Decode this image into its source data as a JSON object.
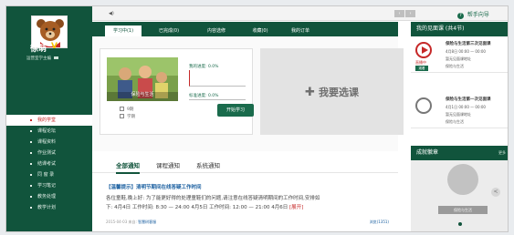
{
  "user": {
    "name": "徐萌",
    "level": "V",
    "role": "运营室学主编"
  },
  "sidebar": {
    "items": [
      {
        "label": "我的学堂",
        "active": true
      },
      {
        "label": "课程论坛",
        "active": false
      },
      {
        "label": "课程资料",
        "active": false
      },
      {
        "label": "作业测试",
        "active": false
      },
      {
        "label": "结课考试",
        "active": false
      },
      {
        "label": "同 窗 录",
        "active": false
      },
      {
        "label": "学习笔记",
        "active": false
      },
      {
        "label": "教务处理",
        "active": false
      },
      {
        "label": "教学计划",
        "active": false
      }
    ]
  },
  "topbar": {
    "prev": "‹",
    "next": "›",
    "help": "帮手向导"
  },
  "tabs": [
    {
      "label": "学习中(1)",
      "active": true
    },
    {
      "label": "已完成(0)",
      "active": false
    },
    {
      "label": "内容选修",
      "active": false
    },
    {
      "label": "收藏(0)",
      "active": false
    },
    {
      "label": "我的订单",
      "active": false
    }
  ],
  "course": {
    "thumb_label": "保险与生活",
    "progress_label": "我的进度: 0.0%",
    "standard_label": "标准进度: 0.0%",
    "meta_1": "9期",
    "meta_2": "学期",
    "start_button": "开始学习",
    "select_button": "我要选课",
    "progress": 0.0,
    "standard_progress": 0.0
  },
  "notices": {
    "tabs": [
      {
        "label": "全部通知",
        "active": true
      },
      {
        "label": "课程通知",
        "active": false
      },
      {
        "label": "系统通知",
        "active": false
      }
    ],
    "title": "【温馨提示】清明节期间在线答疑工作时间",
    "line1": "各位童鞋,晚上好:      为了能更好得的处理童鞋们的问题,请注意在线答疑清明期间的工作时间,安排如",
    "line2_prefix": "下:   4月4日 工作时间: 8:30 — 24:00      4月5日 工作时间: 12:00 — 21:00     4月6日",
    "line2_expand": "[展开]",
    "date": "2015-04-03  来自:",
    "author": "智慧树客服",
    "count": "浏览(1351)"
  },
  "right_panel": {
    "live_header": "我的见面课 (共4节)",
    "live_items": [
      {
        "title": "保险与生活第三次见面课",
        "time": "4月8日 00:00 — 00:00",
        "line2": "暂无见面课地址",
        "line3": "保险与生活",
        "state": "直播中",
        "button": "观看"
      },
      {
        "title": "保险与生活第一次见面课",
        "time": "4月1日 00:00 — 00:00",
        "line2": "暂无见面课地址",
        "line3": "保险与生活",
        "state": "",
        "button": ""
      }
    ],
    "achievement_header": "成就徽章",
    "achievement_more": "更多",
    "badge_label": "保险与生活"
  }
}
